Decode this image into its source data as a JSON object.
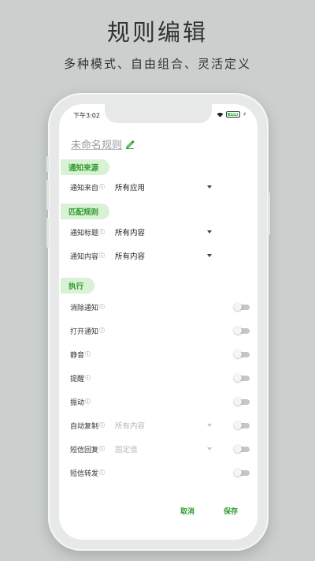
{
  "hero": {
    "title": "规则编辑",
    "subtitle": "多种模式、自由组合、灵活定义"
  },
  "status_bar": {
    "time": "下午3:02",
    "battery_level": "100",
    "icons": [
      "wifi-icon",
      "battery-icon",
      "charging-bolt-icon"
    ]
  },
  "rule": {
    "name": "未命名规则",
    "edit_icon": "pencil-icon"
  },
  "sections": {
    "source": "通知来源",
    "match": "匹配规则",
    "execute": "执行"
  },
  "source_rows": [
    {
      "label": "通知来自",
      "value": "所有应用"
    }
  ],
  "match_rows": [
    {
      "label": "通知标题",
      "value": "所有内容"
    },
    {
      "label": "通知内容",
      "value": "所有内容"
    }
  ],
  "execute_rows": [
    {
      "label": "消除通知",
      "toggle_on": false
    },
    {
      "label": "打开通知",
      "toggle_on": false
    },
    {
      "label": "静音",
      "toggle_on": false
    },
    {
      "label": "提醒",
      "toggle_on": false
    },
    {
      "label": "振动",
      "toggle_on": false
    },
    {
      "label": "自动复制",
      "value": "所有内容",
      "toggle_on": false
    },
    {
      "label": "短信回复",
      "value": "固定值",
      "toggle_on": false
    },
    {
      "label": "短信转发",
      "toggle_on": false
    }
  ],
  "info_glyph": "ⓘ",
  "footer": {
    "cancel": "取消",
    "save": "保存"
  },
  "colors": {
    "accent": "#2e9b2e",
    "tag_background": "#d9f1d4",
    "toggle_off": "#c6c6c6",
    "page_background": "#cbd0ce"
  }
}
